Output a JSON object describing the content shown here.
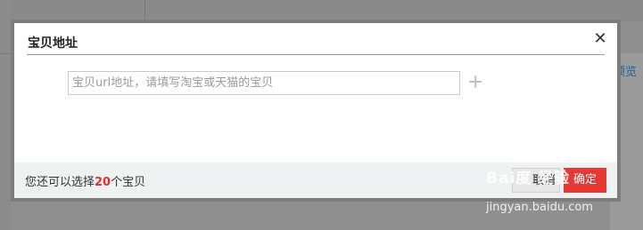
{
  "background": {
    "preview_link": "预览"
  },
  "dialog": {
    "title": "宝贝地址",
    "close_symbol": "✕",
    "url_input": {
      "placeholder": "宝贝url地址，请填写淘宝或天猫的宝贝",
      "value": ""
    },
    "add_symbol": "+",
    "footer": {
      "text_before": "您还可以选择",
      "count": "20",
      "text_after": "个宝贝",
      "cancel_label": "取消",
      "confirm_label": "确定"
    }
  },
  "watermark": {
    "brand": "Bai度 经验",
    "url": "jingyan.baidu.com"
  },
  "colors": {
    "accent_red": "#e53935",
    "count_red": "#e42f2f",
    "link_blue": "#1f5f99"
  }
}
